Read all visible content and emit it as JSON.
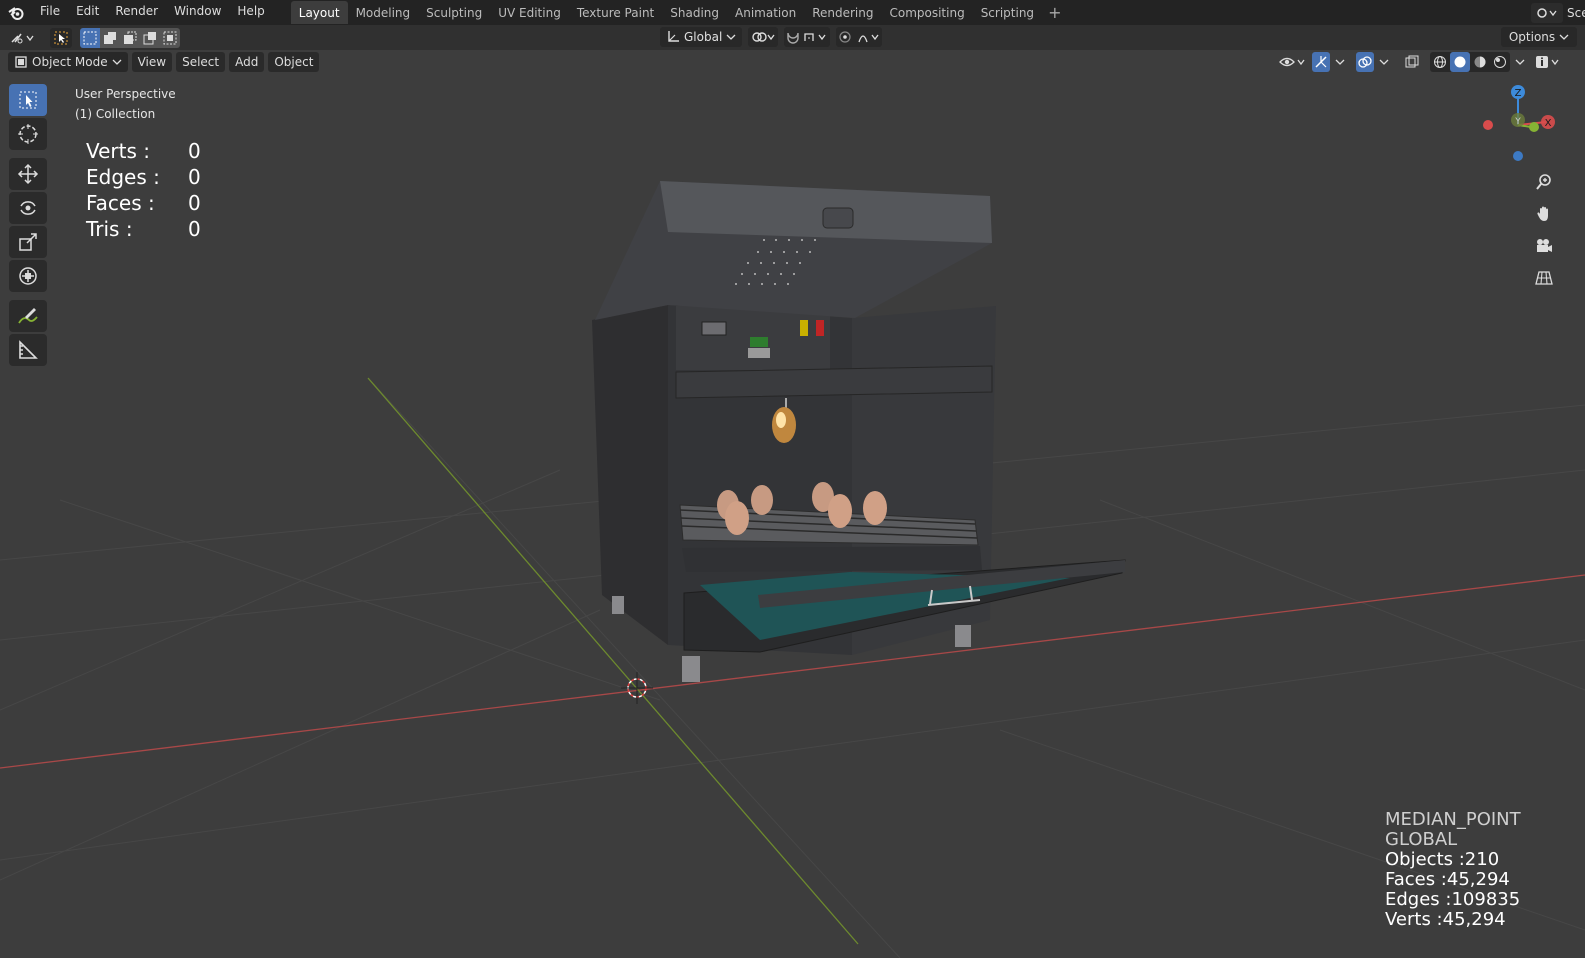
{
  "menu": {
    "file": "File",
    "edit": "Edit",
    "render": "Render",
    "window": "Window",
    "help": "Help"
  },
  "workspaces": [
    "Layout",
    "Modeling",
    "Sculpting",
    "UV Editing",
    "Texture Paint",
    "Shading",
    "Animation",
    "Rendering",
    "Compositing",
    "Scripting"
  ],
  "scene_label": "Scen",
  "tool_header": {
    "orientation": "Global",
    "options": "Options"
  },
  "view_header": {
    "mode": "Object Mode",
    "view": "View",
    "select": "Select",
    "add": "Add",
    "object": "Object"
  },
  "viewport": {
    "perspective": "User Perspective",
    "collection": "(1) Collection",
    "stats": {
      "verts_label": "Verts :",
      "verts": "0",
      "edges_label": "Edges :",
      "edges": "0",
      "faces_label": "Faces :",
      "faces": "0",
      "tris_label": "Tris :",
      "tris": "0"
    },
    "right_info": {
      "pivot": "MEDIAN_POINT",
      "orientation": "GLOBAL",
      "objects": "Objects :210",
      "faces": "Faces :45,294",
      "edges": "Edges :109835",
      "verts": "Verts :45,294"
    }
  },
  "gizmo": {
    "z": "Z",
    "y": "Y",
    "x": "X"
  },
  "colors": {
    "accent": "#4772b3",
    "x_axis": "#d94c4c",
    "y_axis": "#86b334",
    "z_axis": "#3d8bdb"
  }
}
